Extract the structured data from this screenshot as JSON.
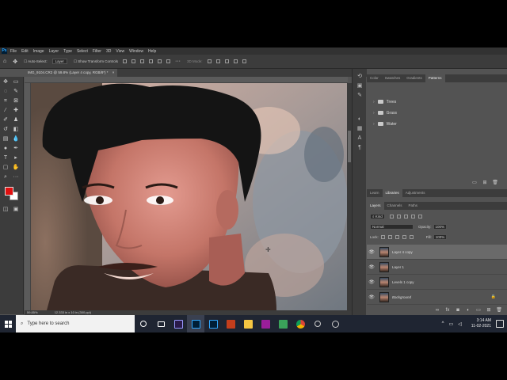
{
  "menubar": {
    "logo": "Ps",
    "items": [
      "File",
      "Edit",
      "Image",
      "Layer",
      "Type",
      "Select",
      "Filter",
      "3D",
      "View",
      "Window",
      "Help"
    ]
  },
  "options": {
    "auto_select": "Auto-Select:",
    "layer_select": "Layer",
    "transform_controls": "Show Transform Controls",
    "mode_3d": "3D Mode:"
  },
  "document": {
    "tab_title": "IMG_9104.CR2 @ 59.8% (Layer 4 copy, RGB/8*) *",
    "zoom": "59.85%",
    "doc_info": "12.333 in x 10 in (300 ppi)"
  },
  "top_panel": {
    "tabs": [
      "Color",
      "Swatches",
      "Gradients",
      "Patterns"
    ],
    "folders": [
      "Trees",
      "Grass",
      "Water"
    ]
  },
  "lib_panel": {
    "tabs": [
      "Learn",
      "Libraries",
      "Adjustments"
    ]
  },
  "layers_panel": {
    "tabs": [
      "Layers",
      "Channels",
      "Paths"
    ],
    "kind": "Kind",
    "blend_mode": "Normal",
    "opacity_label": "Opacity:",
    "opacity_value": "100%",
    "lock_label": "Lock:",
    "fill_label": "Fill:",
    "fill_value": "100%",
    "layers": [
      {
        "name": "Layer 4 copy",
        "selected": true
      },
      {
        "name": "Layer 1",
        "selected": false
      },
      {
        "name": "Levels 1 copy",
        "selected": false
      },
      {
        "name": "Background",
        "selected": false
      }
    ]
  },
  "taskbar": {
    "search_placeholder": "Type here to search",
    "time": "3:14 AM",
    "date": "11-02-2021"
  },
  "colors": {
    "foreground": "#e01010",
    "background": "#ffffff"
  }
}
